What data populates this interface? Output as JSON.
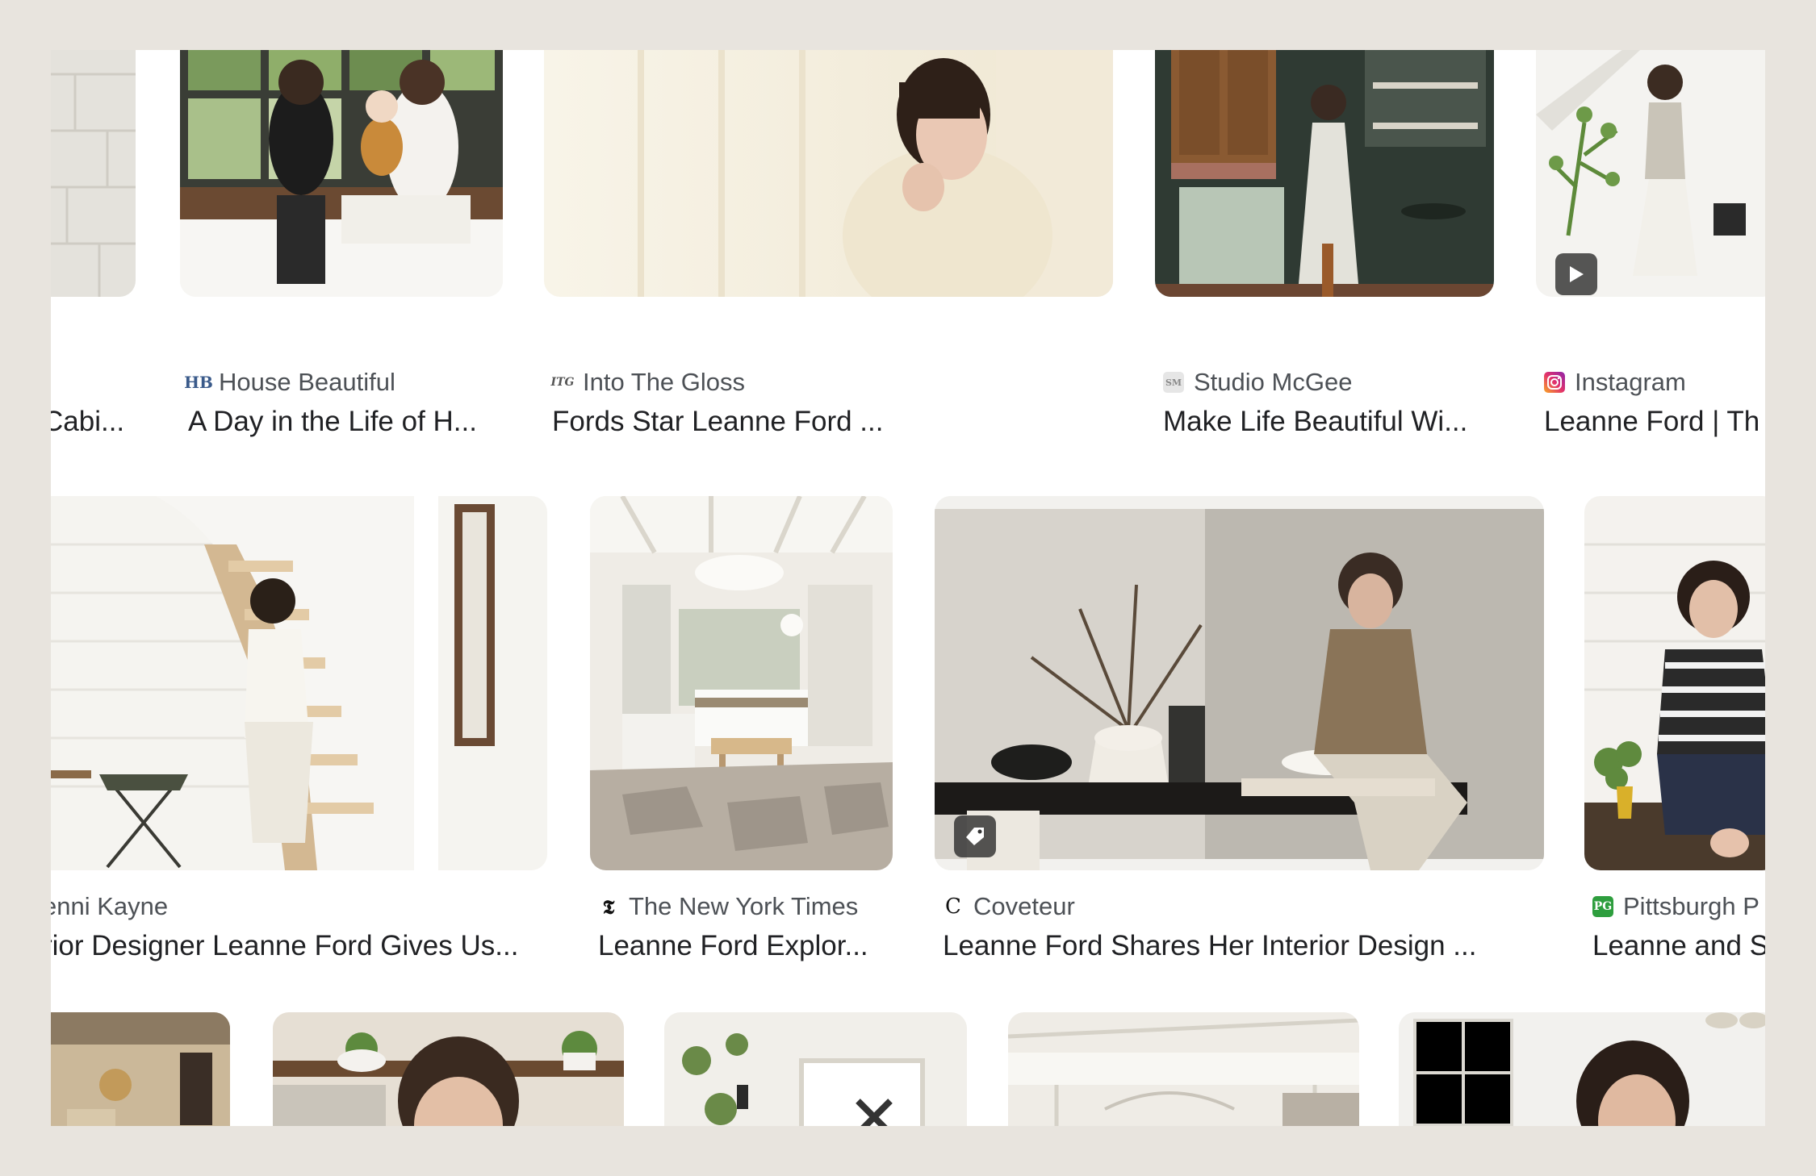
{
  "rows": [
    {
      "cards": [
        {
          "source": "",
          "title": "Cabi...",
          "icon": ""
        },
        {
          "source": "House Beautiful",
          "title": "A Day in the Life of H...",
          "icon": "house-beautiful-logo-icon",
          "icon_text": "HB"
        },
        {
          "source": "Into The Gloss",
          "title": "Fords Star Leanne Ford ...",
          "icon": "into-the-gloss-logo-icon",
          "icon_text": "ITG"
        },
        {
          "source": "Studio McGee",
          "title": "Make Life Beautiful Wi...",
          "icon": "studio-mcgee-logo-icon",
          "icon_text": "SM"
        },
        {
          "source": "Instagram",
          "title": "Leanne Ford | Th",
          "icon": "instagram-logo-icon",
          "badge": "play-icon"
        }
      ]
    },
    {
      "cards": [
        {
          "source": "enni Kayne",
          "title": "rior Designer Leanne Ford Gives Us...",
          "icon": ""
        },
        {
          "source": "The New York Times",
          "title": "Leanne Ford Explor...",
          "icon": "nyt-logo-icon",
          "icon_text": "𝕿"
        },
        {
          "source": "Coveteur",
          "title": "Leanne Ford Shares Her Interior Design ...",
          "icon": "coveteur-logo-icon",
          "icon_text": "C",
          "badge": "price-tag-icon"
        },
        {
          "source": "Pittsburgh P",
          "title": "Leanne and S",
          "icon": "pittsburgh-post-gazette-logo-icon",
          "icon_text": "PG"
        }
      ]
    },
    {
      "cards": [
        {},
        {},
        {},
        {},
        {}
      ]
    }
  ],
  "colors": {
    "page_background": "#e8e4de",
    "instagram": "#e1306c",
    "pittsburgh": "#2e9e3e"
  }
}
